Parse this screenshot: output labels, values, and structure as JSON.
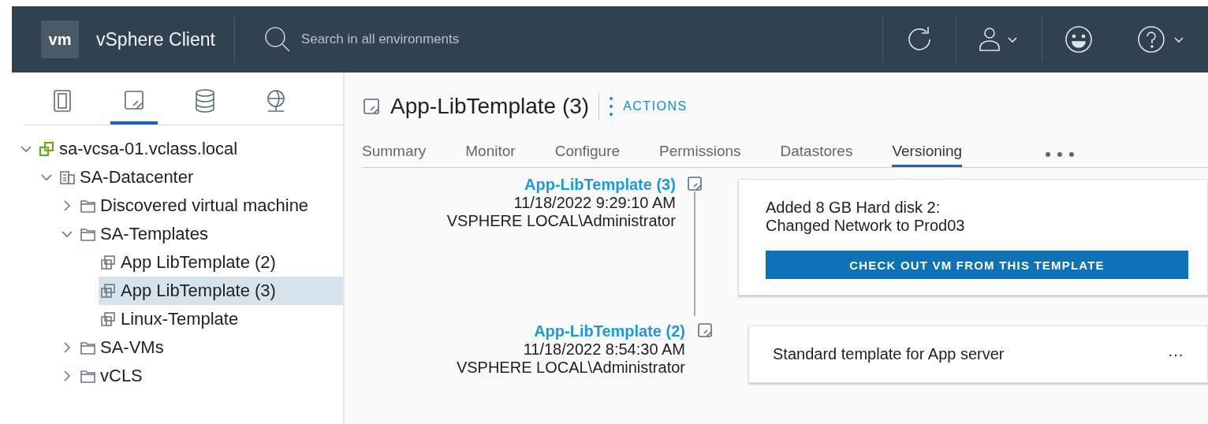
{
  "header": {
    "logo": "vm",
    "title": "vSphere Client",
    "search": {
      "placeholder": "Search in all environments"
    }
  },
  "sidebar": {
    "nav_tabs": [
      {
        "kind": "hosts",
        "selected": false
      },
      {
        "kind": "templates",
        "selected": true
      },
      {
        "kind": "storage",
        "selected": false
      },
      {
        "kind": "network",
        "selected": false
      }
    ],
    "tree": [
      {
        "label": "sa-vcsa-01.vclass.local",
        "kind": "vcenter",
        "expanded": true,
        "selected": false,
        "children": [
          {
            "label": "SA-Datacenter",
            "kind": "datacenter",
            "expanded": true,
            "selected": false,
            "children": [
              {
                "label": "Discovered virtual machine",
                "kind": "folder",
                "expanded": false,
                "selected": false
              },
              {
                "label": "SA-Templates",
                "kind": "folder",
                "expanded": true,
                "selected": false,
                "children": [
                  {
                    "label": "App LibTemplate (2)",
                    "kind": "template",
                    "selected": false
                  },
                  {
                    "label": "App LibTemplate (3)",
                    "kind": "template",
                    "selected": true
                  },
                  {
                    "label": "Linux-Template",
                    "kind": "template",
                    "selected": false
                  }
                ]
              },
              {
                "label": "SA-VMs",
                "kind": "folder",
                "expanded": false,
                "selected": false
              },
              {
                "label": "vCLS",
                "kind": "folder",
                "expanded": false,
                "selected": false
              }
            ]
          }
        ]
      }
    ]
  },
  "main": {
    "title": "App-LibTemplate (3)",
    "actions": "ACTIONS",
    "tabs": [
      {
        "label": "Summary",
        "selected": false
      },
      {
        "label": "Monitor",
        "selected": false
      },
      {
        "label": "Configure",
        "selected": false
      },
      {
        "label": "Permissions",
        "selected": false
      },
      {
        "label": "Datastores",
        "selected": false
      },
      {
        "label": "Versioning",
        "selected": true
      }
    ],
    "versions": [
      {
        "name": "App-LibTemplate (3)",
        "date": "11/18/2022 9:29:10 AM",
        "user": "VSPHERE LOCAL\\Administrator",
        "notes": [
          "Added 8 GB Hard disk 2:",
          "Changed Network to Prod03"
        ],
        "button": "CHECK OUT VM FROM THIS TEMPLATE"
      },
      {
        "name": "App-LibTemplate (2)",
        "date": "11/18/2022 8:54:30 AM",
        "user": "VSPHERE LOCAL\\Administrator",
        "notes": [
          "Standard template for App server"
        ],
        "more": "···"
      }
    ]
  }
}
